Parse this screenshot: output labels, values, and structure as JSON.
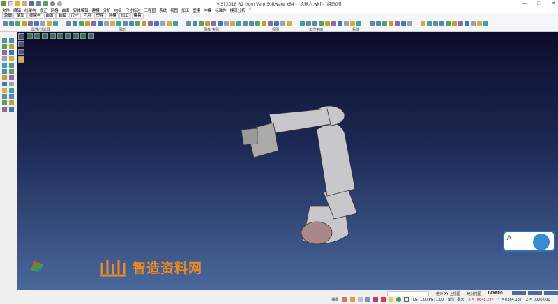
{
  "window": {
    "title": "VISI 2018 R2 from Vero Software x64 - [机器人.wkf - [组态0]]",
    "minimize": "—",
    "maximize": "❐",
    "close": "✕"
  },
  "menu": [
    "文件",
    "编辑",
    "线架构",
    "修正",
    "网格",
    "曲面",
    "实体编辑",
    "建模",
    "分析",
    "电极",
    "尺寸标注",
    "工程图",
    "系统",
    "视图",
    "加工",
    "塑模",
    "冲模",
    "标准件",
    "模流分析",
    "?"
  ],
  "ribbon": {
    "tabs": [
      "轮廓",
      "编辑",
      "线架构",
      "曲面",
      "曲面",
      "尺寸",
      "应用",
      "塑膜",
      "冲模",
      "加工",
      "模具"
    ],
    "active_tab": 0,
    "groups": [
      "属性/过滤器",
      "图形",
      "图像(实际)",
      "视图",
      "工作平面",
      "系统"
    ]
  },
  "watermark": {
    "text": "智造资料网",
    "color": "#f08a20"
  },
  "status": {
    "view_label": "绝对 XY 上视图",
    "abs_view": "绝对视图",
    "layer": "LAYER0",
    "snap": "捕捉",
    "lg_pg": "LG: 1.00  PG: 1.00",
    "unit": "单位: 毫米",
    "x": "X = -0648.297",
    "y": "Y = 0364.187",
    "z": "Z = 0000.000"
  },
  "nav_widget": {
    "label": "A"
  }
}
